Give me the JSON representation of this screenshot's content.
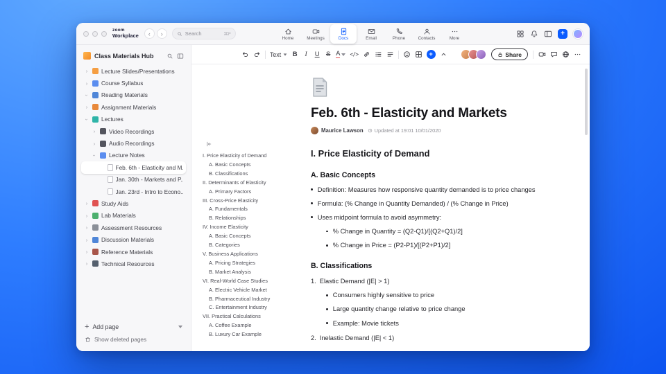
{
  "colors": {
    "accent": "#0b5cff"
  },
  "titlebar": {
    "logo_line1": "zoom",
    "logo_line2": "Workplace",
    "search": {
      "placeholder": "Search",
      "shortcut": "⌘F"
    },
    "nav_tabs": [
      {
        "id": "home",
        "label": "Home",
        "icon": "home-icon",
        "active": false
      },
      {
        "id": "meetings",
        "label": "Meetings",
        "icon": "meetings-icon",
        "active": false
      },
      {
        "id": "docs",
        "label": "Docs",
        "icon": "docs-icon",
        "active": true
      },
      {
        "id": "email",
        "label": "Email",
        "icon": "email-icon",
        "active": false
      },
      {
        "id": "phone",
        "label": "Phone",
        "icon": "phone-icon",
        "active": false
      },
      {
        "id": "contacts",
        "label": "Contacts",
        "icon": "contacts-icon",
        "active": false
      },
      {
        "id": "more",
        "label": "More",
        "icon": "more-icon",
        "active": false
      }
    ],
    "right_icons": [
      "apps-icon",
      "bell-icon",
      "panel-icon",
      "plus-button",
      "profile-avatar"
    ]
  },
  "sidebar": {
    "title": "Class Materials Hub",
    "items": [
      {
        "label": "Lecture Slides/Presentations",
        "icon": "presentation-icon",
        "color": "#f59e42",
        "level": 0,
        "chevron": "right"
      },
      {
        "label": "Course Syllabus",
        "icon": "syllabus-icon",
        "color": "#5b8def",
        "level": 0,
        "chevron": "right"
      },
      {
        "label": "Reading Materials",
        "icon": "book-icon",
        "color": "#4f86d8",
        "level": 0,
        "chevron": "down"
      },
      {
        "label": "Assignment Materials",
        "icon": "assignment-icon",
        "color": "#e8883a",
        "level": 0,
        "chevron": "right"
      },
      {
        "label": "Lectures",
        "icon": "lectures-icon",
        "color": "#2fb4a8",
        "level": 0,
        "chevron": "down"
      },
      {
        "label": "Video Recordings",
        "icon": "video-icon",
        "color": "#54555e",
        "level": 1,
        "chevron": "right"
      },
      {
        "label": "Audio Recordings",
        "icon": "audio-icon",
        "color": "#54555e",
        "level": 1,
        "chevron": "right"
      },
      {
        "label": "Lecture Notes",
        "icon": "notes-icon",
        "color": "#5b8def",
        "level": 1,
        "chevron": "down"
      },
      {
        "label": "Feb. 6th - Elasticity and M...",
        "icon": "page-icon",
        "level": 2,
        "chevron": "none",
        "selected": true
      },
      {
        "label": "Jan. 30th - Markets and P...",
        "icon": "page-icon",
        "level": 2,
        "chevron": "none"
      },
      {
        "label": "Jan. 23rd - Intro to Econo...",
        "icon": "page-icon",
        "level": 2,
        "chevron": "none"
      },
      {
        "label": "Study Aids",
        "icon": "study-aids-icon",
        "color": "#e05252",
        "level": 0,
        "chevron": "right"
      },
      {
        "label": "Lab Materials",
        "icon": "lab-icon",
        "color": "#4caf6e",
        "level": 0,
        "chevron": "right"
      },
      {
        "label": "Assessment Resources",
        "icon": "assessment-icon",
        "color": "#8a8f98",
        "level": 0,
        "chevron": "right"
      },
      {
        "label": "Discussion Materials",
        "icon": "discussion-icon",
        "color": "#4f86d8",
        "level": 0,
        "chevron": "right"
      },
      {
        "label": "Reference Materials",
        "icon": "reference-icon",
        "color": "#a8554a",
        "level": 0,
        "chevron": "right"
      },
      {
        "label": "Technical Resources",
        "icon": "technical-icon",
        "color": "#55606e",
        "level": 0,
        "chevron": "right"
      }
    ],
    "add_page": "Add page",
    "show_deleted": "Show deleted pages"
  },
  "toolbar": {
    "share_label": "Share",
    "items": [
      {
        "name": "undo-icon"
      },
      {
        "name": "redo-icon"
      },
      {
        "type": "divider"
      },
      {
        "type": "dropdown",
        "name": "text-style-dropdown",
        "label": "Text"
      },
      {
        "type": "glyph",
        "name": "bold-icon",
        "glyph": "B",
        "cls": "bold"
      },
      {
        "type": "glyph",
        "name": "italic-icon",
        "glyph": "I",
        "cls": "ital"
      },
      {
        "type": "glyph",
        "name": "underline-icon",
        "glyph": "U",
        "cls": "und"
      },
      {
        "type": "glyph",
        "name": "strikethrough-icon",
        "glyph": "S",
        "cls": "strk"
      },
      {
        "type": "glyph",
        "name": "text-color-icon",
        "glyph": "A",
        "cls": "acolor",
        "caret": true
      },
      {
        "type": "glyph",
        "name": "code-icon",
        "glyph": "</>",
        "cls": "codeg"
      },
      {
        "name": "link-icon"
      },
      {
        "name": "bullet-list-icon"
      },
      {
        "name": "align-icon"
      },
      {
        "type": "divider"
      },
      {
        "name": "emoji-icon"
      },
      {
        "name": "table-icon"
      },
      {
        "name": "insert-plus-icon"
      },
      {
        "name": "collapse-toolbar-icon"
      }
    ],
    "avatars": [
      [
        "#f2b27f",
        "#c9824f"
      ],
      [
        "#e89090",
        "#b85a5a"
      ],
      [
        "#c9a3e8",
        "#8a5fb8"
      ]
    ],
    "right_items": [
      "camera-icon",
      "chat-icon",
      "globe-icon",
      "more-icon"
    ]
  },
  "document": {
    "title": "Feb. 6th - Elasticity and Markets",
    "author": "Maurice Lawson",
    "updated": "Updated at 19:01 10/01/2020",
    "toc": [
      {
        "label": "I. Price Elasticity of Demand",
        "level": 0
      },
      {
        "label": "A. Basic Concepts",
        "level": 1
      },
      {
        "label": "B. Classifications",
        "level": 1
      },
      {
        "label": "II. Determinants of Elasticity",
        "level": 0
      },
      {
        "label": "A. Primary Factors",
        "level": 1
      },
      {
        "label": "III. Cross-Price Elasticity",
        "level": 0
      },
      {
        "label": "A. Fundamentals",
        "level": 1
      },
      {
        "label": "B. Relationships",
        "level": 1
      },
      {
        "label": "IV. Income Elasticity",
        "level": 0
      },
      {
        "label": "A. Basic Concepts",
        "level": 1
      },
      {
        "label": "B. Categories",
        "level": 1
      },
      {
        "label": "V. Business Applications",
        "level": 0
      },
      {
        "label": "A. Pricing Strategies",
        "level": 1
      },
      {
        "label": "B. Market Analysis",
        "level": 1
      },
      {
        "label": "VI. Real-World Case Studies",
        "level": 0
      },
      {
        "label": "A. Electric Vehicle Market",
        "level": 1
      },
      {
        "label": "B. Pharmaceutical Industry",
        "level": 1
      },
      {
        "label": "C. Entertainment Industry",
        "level": 1
      },
      {
        "label": "VII. Practical Calculations",
        "level": 0
      },
      {
        "label": "A. Coffee Example",
        "level": 1
      },
      {
        "label": "B. Luxury Car Example",
        "level": 1
      }
    ],
    "content": [
      {
        "type": "h1",
        "text": "I. Price Elasticity of Demand"
      },
      {
        "type": "h2",
        "text": "A. Basic Concepts"
      },
      {
        "type": "bullet",
        "level": 0,
        "text": "Definition: Measures how responsive quantity demanded is to price changes"
      },
      {
        "type": "bullet",
        "level": 0,
        "text": "Formula: (% Change in Quantity Demanded) / (% Change in Price)"
      },
      {
        "type": "bullet",
        "level": 0,
        "text": "Uses midpoint formula to avoid asymmetry:"
      },
      {
        "type": "bullet",
        "level": 1,
        "text": "% Change in Quantity = (Q2-Q1)/[(Q2+Q1)/2]"
      },
      {
        "type": "bullet",
        "level": 1,
        "text": "% Change in Price = (P2-P1)/[(P2+P1)/2]"
      },
      {
        "type": "h2",
        "text": "B. Classifications"
      },
      {
        "type": "number",
        "num": "1.",
        "text": "Elastic Demand (|E| > 1)"
      },
      {
        "type": "bullet",
        "level": 1,
        "text": "Consumers highly sensitive to price"
      },
      {
        "type": "bullet",
        "level": 1,
        "text": "Large quantity change relative to price change"
      },
      {
        "type": "bullet",
        "level": 1,
        "text": "Example: Movie tickets"
      },
      {
        "type": "number",
        "num": "2.",
        "text": "Inelastic Demand (|E| < 1)"
      }
    ]
  }
}
